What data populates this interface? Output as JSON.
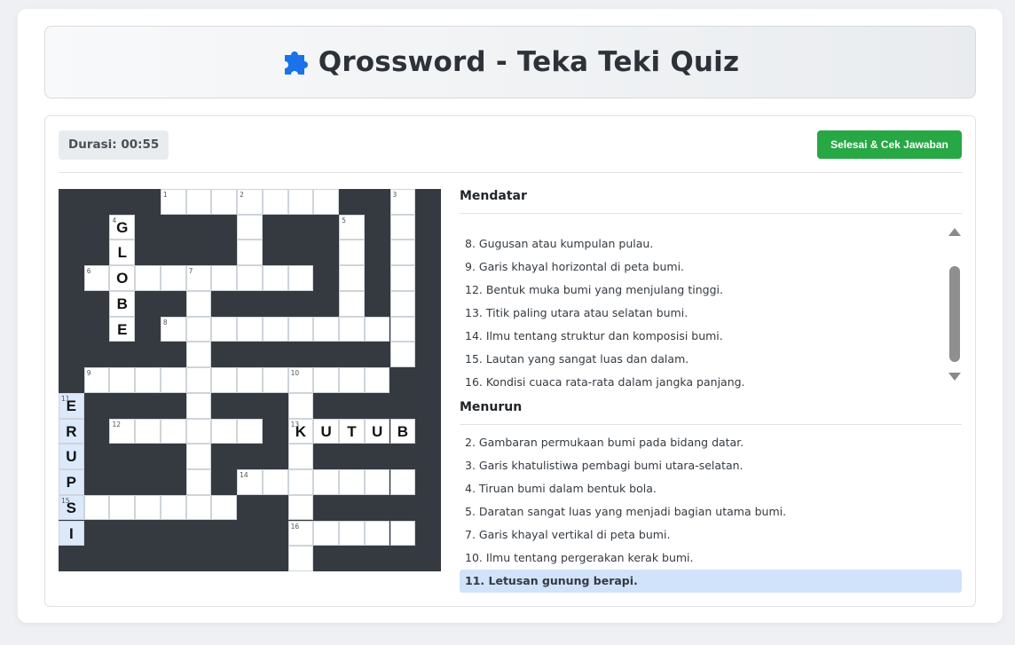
{
  "header": {
    "title": "Qrossword - Teka Teki Quiz",
    "icon": "puzzle-icon",
    "icon_color": "#1a73e8"
  },
  "toolbar": {
    "timer": "Durasi: 00:55",
    "done_label": "Selesai & Cek Jawaban",
    "done_color": "#28a745"
  },
  "grid": {
    "size": 15,
    "white_cells": [
      [
        0,
        4
      ],
      [
        0,
        5
      ],
      [
        0,
        6
      ],
      [
        0,
        7
      ],
      [
        0,
        8
      ],
      [
        0,
        9
      ],
      [
        0,
        10
      ],
      [
        0,
        13
      ],
      [
        1,
        2
      ],
      [
        1,
        7
      ],
      [
        1,
        11
      ],
      [
        1,
        13
      ],
      [
        2,
        2
      ],
      [
        2,
        7
      ],
      [
        2,
        11
      ],
      [
        2,
        13
      ],
      [
        3,
        1
      ],
      [
        3,
        2
      ],
      [
        3,
        3
      ],
      [
        3,
        4
      ],
      [
        3,
        5
      ],
      [
        3,
        6
      ],
      [
        3,
        7
      ],
      [
        3,
        8
      ],
      [
        3,
        9
      ],
      [
        3,
        11
      ],
      [
        3,
        13
      ],
      [
        4,
        2
      ],
      [
        4,
        5
      ],
      [
        4,
        11
      ],
      [
        4,
        13
      ],
      [
        5,
        2
      ],
      [
        5,
        4
      ],
      [
        5,
        5
      ],
      [
        5,
        6
      ],
      [
        5,
        7
      ],
      [
        5,
        8
      ],
      [
        5,
        9
      ],
      [
        5,
        10
      ],
      [
        5,
        11
      ],
      [
        5,
        12
      ],
      [
        5,
        13
      ],
      [
        6,
        5
      ],
      [
        6,
        13
      ],
      [
        7,
        1
      ],
      [
        7,
        2
      ],
      [
        7,
        3
      ],
      [
        7,
        4
      ],
      [
        7,
        5
      ],
      [
        7,
        6
      ],
      [
        7,
        7
      ],
      [
        7,
        8
      ],
      [
        7,
        9
      ],
      [
        7,
        10
      ],
      [
        7,
        11
      ],
      [
        7,
        12
      ],
      [
        8,
        0
      ],
      [
        8,
        5
      ],
      [
        8,
        9
      ],
      [
        9,
        0
      ],
      [
        9,
        2
      ],
      [
        9,
        3
      ],
      [
        9,
        4
      ],
      [
        9,
        5
      ],
      [
        9,
        6
      ],
      [
        9,
        7
      ],
      [
        9,
        9
      ],
      [
        9,
        10
      ],
      [
        9,
        11
      ],
      [
        9,
        12
      ],
      [
        9,
        13
      ],
      [
        10,
        0
      ],
      [
        10,
        5
      ],
      [
        10,
        9
      ],
      [
        11,
        0
      ],
      [
        11,
        5
      ],
      [
        11,
        7
      ],
      [
        11,
        8
      ],
      [
        11,
        9
      ],
      [
        11,
        10
      ],
      [
        11,
        11
      ],
      [
        11,
        12
      ],
      [
        11,
        13
      ],
      [
        12,
        0
      ],
      [
        12,
        1
      ],
      [
        12,
        2
      ],
      [
        12,
        3
      ],
      [
        12,
        4
      ],
      [
        12,
        5
      ],
      [
        12,
        6
      ],
      [
        12,
        9
      ],
      [
        13,
        0
      ],
      [
        13,
        9
      ],
      [
        13,
        10
      ],
      [
        13,
        11
      ],
      [
        13,
        12
      ],
      [
        13,
        13
      ],
      [
        14,
        9
      ]
    ],
    "highlighted_cells": [
      [
        8,
        0
      ],
      [
        9,
        0
      ],
      [
        10,
        0
      ],
      [
        11,
        0
      ],
      [
        12,
        0
      ],
      [
        13,
        0
      ]
    ],
    "numbers": [
      {
        "r": 0,
        "c": 4,
        "n": "1"
      },
      {
        "r": 0,
        "c": 7,
        "n": "2"
      },
      {
        "r": 0,
        "c": 13,
        "n": "3"
      },
      {
        "r": 1,
        "c": 2,
        "n": "4"
      },
      {
        "r": 1,
        "c": 11,
        "n": "5"
      },
      {
        "r": 3,
        "c": 1,
        "n": "6"
      },
      {
        "r": 3,
        "c": 5,
        "n": "7"
      },
      {
        "r": 5,
        "c": 4,
        "n": "8"
      },
      {
        "r": 7,
        "c": 1,
        "n": "9"
      },
      {
        "r": 7,
        "c": 9,
        "n": "10"
      },
      {
        "r": 8,
        "c": 0,
        "n": "11"
      },
      {
        "r": 9,
        "c": 2,
        "n": "12"
      },
      {
        "r": 9,
        "c": 9,
        "n": "13"
      },
      {
        "r": 11,
        "c": 7,
        "n": "14"
      },
      {
        "r": 12,
        "c": 0,
        "n": "15"
      },
      {
        "r": 13,
        "c": 9,
        "n": "16"
      }
    ],
    "letters": [
      {
        "r": 1,
        "c": 2,
        "ch": "G"
      },
      {
        "r": 2,
        "c": 2,
        "ch": "L"
      },
      {
        "r": 3,
        "c": 2,
        "ch": "O"
      },
      {
        "r": 4,
        "c": 2,
        "ch": "B"
      },
      {
        "r": 5,
        "c": 2,
        "ch": "E"
      },
      {
        "r": 9,
        "c": 9,
        "ch": "K"
      },
      {
        "r": 9,
        "c": 10,
        "ch": "U"
      },
      {
        "r": 9,
        "c": 11,
        "ch": "T"
      },
      {
        "r": 9,
        "c": 12,
        "ch": "U"
      },
      {
        "r": 9,
        "c": 13,
        "ch": "B"
      },
      {
        "r": 8,
        "c": 0,
        "ch": "E"
      },
      {
        "r": 9,
        "c": 0,
        "ch": "R"
      },
      {
        "r": 10,
        "c": 0,
        "ch": "U"
      },
      {
        "r": 11,
        "c": 0,
        "ch": "P"
      },
      {
        "r": 12,
        "c": 0,
        "ch": "S"
      },
      {
        "r": 13,
        "c": 0,
        "ch": "I"
      }
    ]
  },
  "clues": {
    "across_title": "Mendatar",
    "across": [
      "8. Gugusan atau kumpulan pulau.",
      "9. Garis khayal horizontal di peta bumi.",
      "12. Bentuk muka bumi yang menjulang tinggi.",
      "13. Titik paling utara atau selatan bumi.",
      "14. Ilmu tentang struktur dan komposisi bumi.",
      "15. Lautan yang sangat luas dan dalam.",
      "16. Kondisi cuaca rata-rata dalam jangka panjang."
    ],
    "down_title": "Menurun",
    "down": [
      "2. Gambaran permukaan bumi pada bidang datar.",
      "3. Garis khatulistiwa pembagi bumi utara-selatan.",
      "4. Tiruan bumi dalam bentuk bola.",
      "5. Daratan sangat luas yang menjadi bagian utama bumi.",
      "7. Garis khayal vertikal di peta bumi.",
      "10. Ilmu tentang pergerakan kerak bumi.",
      "11. Letusan gunung berapi."
    ],
    "down_active_index": 6
  }
}
